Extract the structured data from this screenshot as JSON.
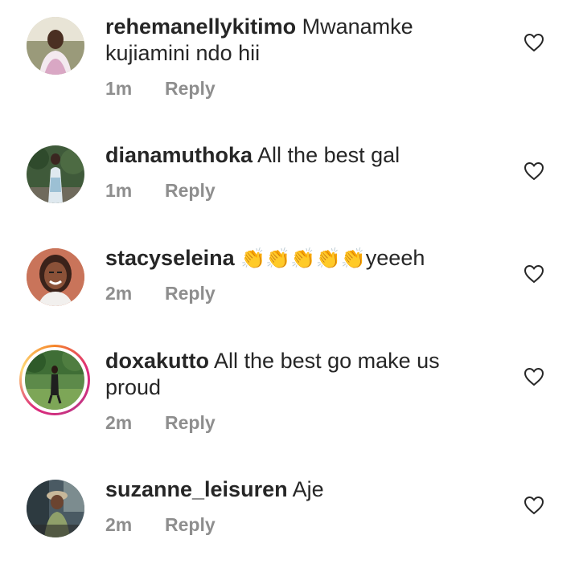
{
  "comments": [
    {
      "username": "rehemanellykitimo",
      "text": "Mwanamke kujiamini ndo hii",
      "time": "1m",
      "reply_label": "Reply",
      "has_story": false
    },
    {
      "username": "dianamuthoka",
      "text": "All the best gal",
      "time": "1m",
      "reply_label": "Reply",
      "has_story": false
    },
    {
      "username": "stacyseleina",
      "emoji": "👏👏👏👏👏",
      "text": "yeeeh",
      "time": "2m",
      "reply_label": "Reply",
      "has_story": false
    },
    {
      "username": "doxakutto",
      "text": "All the best go make us proud",
      "time": "2m",
      "reply_label": "Reply",
      "has_story": true
    },
    {
      "username": "suzanne_leisuren",
      "text": "Aje",
      "time": "2m",
      "reply_label": "Reply",
      "has_story": false
    }
  ],
  "icons": {
    "like": "heart-outline-icon"
  },
  "colors": {
    "text": "#262626",
    "meta": "#8e8e8e",
    "story_gradient": [
      "#f58529",
      "#dd2a7b",
      "#feda77"
    ]
  }
}
